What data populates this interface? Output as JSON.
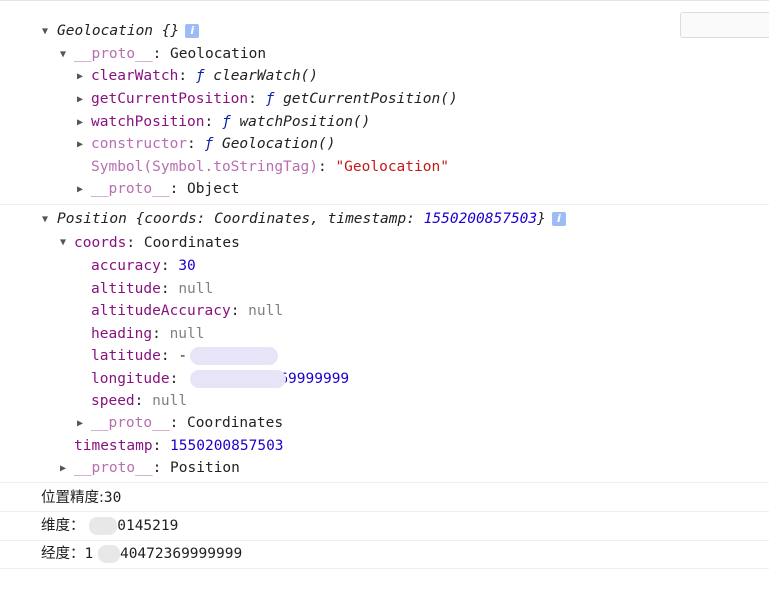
{
  "geolocation": {
    "header": "Geolocation {}",
    "proto_key": "__proto__",
    "proto_type": "Geolocation",
    "methods": [
      {
        "key": "clearWatch",
        "f": "ƒ",
        "name": "clearWatch()"
      },
      {
        "key": "getCurrentPosition",
        "f": "ƒ",
        "name": "getCurrentPosition()"
      },
      {
        "key": "watchPosition",
        "f": "ƒ",
        "name": "watchPosition()"
      },
      {
        "key": "constructor",
        "f": "ƒ",
        "name": "Geolocation()"
      }
    ],
    "symbol_key": "Symbol(Symbol.toStringTag)",
    "symbol_value": "\"Geolocation\"",
    "proto2_key": "__proto__",
    "proto2_type": "Object"
  },
  "position": {
    "header_prefix": "Position {coords: Coordinates, timestamp: ",
    "header_ts": "1550200857503",
    "header_suffix": "}",
    "coords_key": "coords",
    "coords_type": "Coordinates",
    "accuracy_key": "accuracy",
    "accuracy_val": "30",
    "altitude_key": "altitude",
    "altitude_val": "null",
    "altacc_key": "altitudeAccuracy",
    "altacc_val": "null",
    "heading_key": "heading",
    "heading_val": "null",
    "latitude_key": "latitude",
    "latitude_val": "-",
    "longitude_key": "longitude",
    "longitude_val": "69999999",
    "speed_key": "speed",
    "speed_val": "null",
    "proto3_key": "__proto__",
    "proto3_type": "Coordinates",
    "timestamp_key": "timestamp",
    "timestamp_val": "1550200857503",
    "proto4_key": "__proto__",
    "proto4_type": "Position"
  },
  "logs": {
    "accuracy_label": "位置精度:",
    "accuracy_value": "30",
    "lat_label": "维度：",
    "lat_value": ".0145219",
    "lng_label": "经度：",
    "lng_prefix": "1",
    "lng_value": ".40472369999999"
  },
  "ui": {
    "info_glyph": "i",
    "expand_arrow": "▼",
    "collapse_arrow": "▶"
  }
}
